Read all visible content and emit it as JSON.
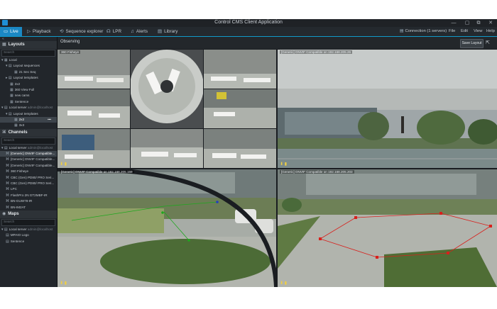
{
  "window": {
    "title": "Control CMS Client Application",
    "controls": [
      "—",
      "▢",
      "⧉",
      "✕"
    ]
  },
  "nav": {
    "tabs": [
      {
        "label": "Live",
        "icon": "live-icon",
        "glyph": "▭"
      },
      {
        "label": "Playback",
        "icon": "playback-icon",
        "glyph": "▷"
      },
      {
        "label": "Sequence explorer",
        "icon": "sequence-explorer-icon",
        "glyph": "⟲"
      },
      {
        "label": "LPR",
        "icon": "lpr-icon",
        "glyph": "☊"
      },
      {
        "label": "Alerts",
        "icon": "alerts-icon",
        "glyph": "♫"
      },
      {
        "label": "Library",
        "icon": "library-icon",
        "glyph": "▤"
      }
    ],
    "connection": "Connection (1 servers)",
    "menu": [
      "File",
      "Edit",
      "View",
      "Help"
    ]
  },
  "sidebar": {
    "collapse_glyph": "«",
    "layouts": {
      "header": "Layouts",
      "search_placeholder": "Search",
      "items": [
        {
          "text": "Local",
          "glyph": "▾ ▦",
          "indent": 2,
          "selected": false
        },
        {
          "text": "Layout sequences",
          "glyph": "▾ ▤",
          "indent": 8,
          "selected": false
        },
        {
          "text": "21 Sec Seq",
          "glyph": "▦",
          "indent": 20,
          "selected": false
        },
        {
          "text": "Layout templates",
          "glyph": "▸ ▤",
          "indent": 8,
          "selected": false
        },
        {
          "text": "2x2",
          "glyph": "▦",
          "indent": 14,
          "selected": false
        },
        {
          "text": "360 View Full",
          "glyph": "▦",
          "indent": 14,
          "selected": false
        },
        {
          "text": "new cams",
          "glyph": "▦",
          "indent": 14,
          "selected": false
        },
        {
          "text": "Sentence",
          "glyph": "▦",
          "indent": 14,
          "selected": false
        },
        {
          "text": "Local server",
          "sub": "admin@localhost",
          "glyph": "▾ ▤",
          "indent": 2,
          "selected": false
        },
        {
          "text": "Layout templates",
          "glyph": "▾ ▤",
          "indent": 8,
          "selected": false
        },
        {
          "text": "2x2",
          "glyph": "▦",
          "indent": 20,
          "selected": true,
          "more": "•••"
        },
        {
          "text": "3x3",
          "glyph": "▦",
          "indent": 20,
          "selected": false
        }
      ]
    },
    "channels": {
      "header": "Channels",
      "search_placeholder": "Search",
      "items": [
        {
          "text": "Local server",
          "sub": "admin@localhost",
          "glyph": "▾ ▤",
          "indent": 2,
          "selected": false
        },
        {
          "text": "[Generic] ONVIF Compatible...",
          "glyph": "⌘",
          "indent": 8,
          "selected": true
        },
        {
          "text": "[Generic] ONVIF Compatible...",
          "glyph": "⌘",
          "indent": 8,
          "selected": false
        },
        {
          "text": "[Generic] ONVIF Compatible...",
          "glyph": "⌘",
          "indent": 8,
          "selected": false
        },
        {
          "text": "360 Fisheye",
          "glyph": "⌘",
          "indent": 8,
          "selected": false
        },
        {
          "text": "CBC (Gen) PD80/ PRO Seri...",
          "glyph": "⌘",
          "indent": 8,
          "selected": false
        },
        {
          "text": "CBC (Gen) PD80/ PRO Seri...",
          "glyph": "⌘",
          "indent": 8,
          "selected": false
        },
        {
          "text": "LPC",
          "glyph": "⌘",
          "indent": 8,
          "selected": false
        },
        {
          "text": "FlashPro 2N GT2MBF-IR",
          "glyph": "⌘",
          "indent": 8,
          "selected": false
        },
        {
          "text": "BN-GUW78-IR",
          "glyph": "⌘",
          "indent": 8,
          "selected": false
        },
        {
          "text": "BN-IM2AT",
          "glyph": "⌘",
          "indent": 8,
          "selected": false
        }
      ]
    },
    "maps": {
      "header": "Maps",
      "search_placeholder": "Search",
      "items": [
        {
          "text": "Local server",
          "sub": "admin@localhost",
          "glyph": "▾ ▤",
          "indent": 2,
          "selected": false
        },
        {
          "text": "MPAIO Logo",
          "glyph": "▤",
          "indent": 8,
          "selected": false
        },
        {
          "text": "Sentence",
          "glyph": "▤",
          "indent": 8,
          "selected": false
        }
      ]
    }
  },
  "main": {
    "title": "Observing",
    "save_layout": "Save Layout",
    "popout_icon": "popout-icon",
    "tiles": [
      {
        "label": "360 Fisheye",
        "name": "fisheye"
      },
      {
        "label": "[Generic] ONVIF Compatible on 192.168.205.26",
        "name": "exterior"
      },
      {
        "label": "[Generic] ONVIF Compatible on 192.168.205.159",
        "name": "courtyard-left"
      },
      {
        "label": "[Generic] ONVIF Compatible on 192.168.205.203",
        "name": "courtyard-right"
      }
    ],
    "tile_controls": "⬇ ▮"
  },
  "colors": {
    "accent": "#1b88c4",
    "panel": "#22262b",
    "background": "#1a1d21",
    "analytics_green": "#1ea81e",
    "analytics_red": "#d8201c"
  }
}
